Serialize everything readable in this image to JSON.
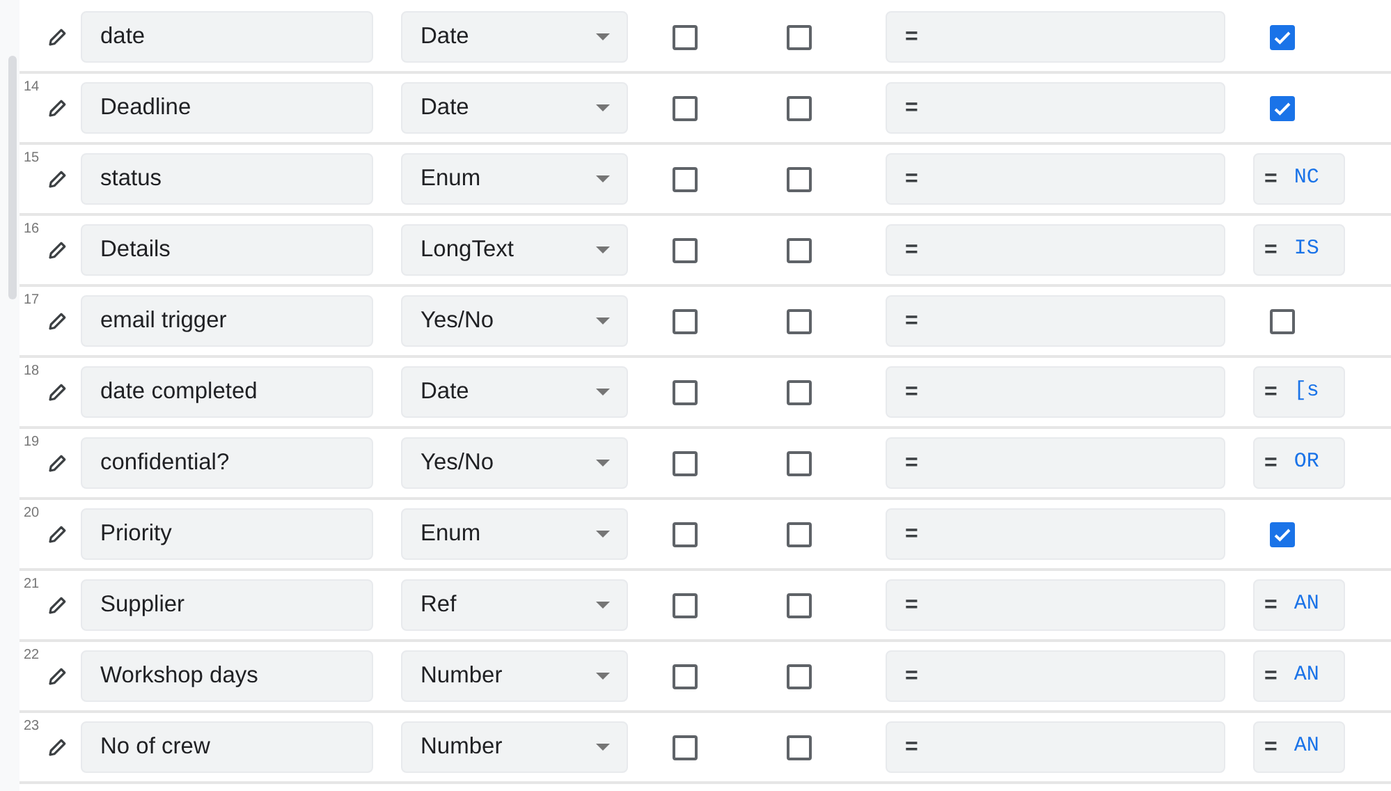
{
  "rows": [
    {
      "name": "date",
      "type": "Date",
      "key": false,
      "label": false,
      "formula": "=",
      "extra": {
        "kind": "checkbox",
        "checked": true
      }
    },
    {
      "number": "14",
      "name": "Deadline",
      "type": "Date",
      "key": false,
      "label": false,
      "formula": "=",
      "extra": {
        "kind": "checkbox",
        "checked": true
      }
    },
    {
      "number": "15",
      "name": "status",
      "type": "Enum",
      "key": false,
      "label": false,
      "formula": "=",
      "extra": {
        "kind": "formula",
        "prefix": "=",
        "text": "NC"
      }
    },
    {
      "number": "16",
      "name": "Details",
      "type": "LongText",
      "key": false,
      "label": false,
      "formula": "=",
      "extra": {
        "kind": "formula",
        "prefix": "=",
        "text": "IS"
      }
    },
    {
      "number": "17",
      "name": "email trigger",
      "type": "Yes/No",
      "key": false,
      "label": false,
      "formula": "=",
      "extra": {
        "kind": "checkbox",
        "checked": false
      }
    },
    {
      "number": "18",
      "name": "date completed",
      "type": "Date",
      "key": false,
      "label": false,
      "formula": "=",
      "extra": {
        "kind": "formula",
        "prefix": "=",
        "text": "[s"
      }
    },
    {
      "number": "19",
      "name": "confidential?",
      "type": "Yes/No",
      "key": false,
      "label": false,
      "formula": "=",
      "extra": {
        "kind": "formula",
        "prefix": "=",
        "text": "OR"
      }
    },
    {
      "number": "20",
      "name": "Priority",
      "type": "Enum",
      "key": false,
      "label": false,
      "formula": "=",
      "extra": {
        "kind": "checkbox",
        "checked": true
      }
    },
    {
      "number": "21",
      "name": "Supplier",
      "type": "Ref",
      "key": false,
      "label": false,
      "formula": "=",
      "extra": {
        "kind": "formula",
        "prefix": "=",
        "text": "AN"
      }
    },
    {
      "number": "22",
      "name": "Workshop days",
      "type": "Number",
      "key": false,
      "label": false,
      "formula": "=",
      "extra": {
        "kind": "formula",
        "prefix": "=",
        "text": "AN"
      }
    },
    {
      "number": "23",
      "name": "No of crew",
      "type": "Number",
      "key": false,
      "label": false,
      "formula": "=",
      "extra": {
        "kind": "formula",
        "prefix": "=",
        "text": "AN"
      }
    }
  ]
}
